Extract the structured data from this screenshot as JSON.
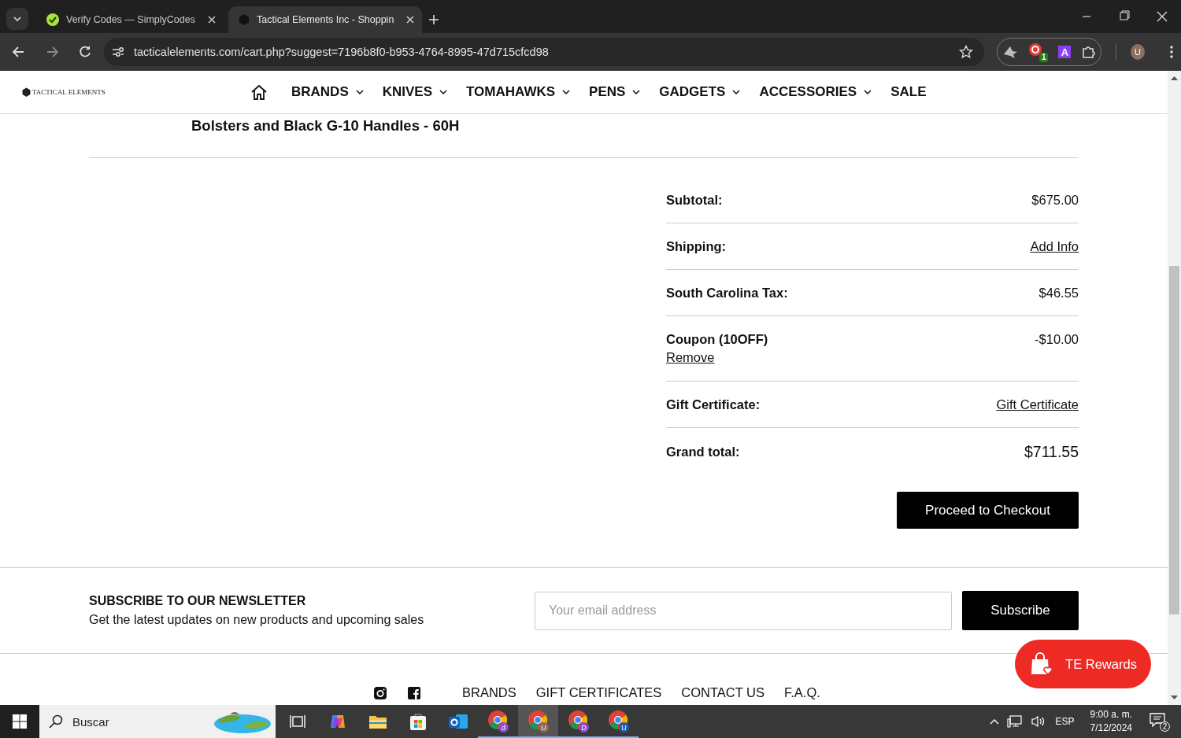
{
  "browser": {
    "tabs": [
      {
        "title": "Verify Codes — SimplyCodes",
        "selected": false
      },
      {
        "title": "Tactical Elements Inc - Shoppin",
        "selected": true
      }
    ],
    "url": "tacticalelements.com/cart.php?suggest=7196b8f0-b953-4764-8995-47d715cfcd98",
    "extension_badge": "1",
    "extension_letter": "A",
    "profile_initial": "U"
  },
  "site": {
    "logo": "TACTICAL ELEMENTS",
    "nav": [
      {
        "label": "BRANDS",
        "kind": "menu"
      },
      {
        "label": "KNIVES",
        "kind": "menu"
      },
      {
        "label": "TOMAHAWKS",
        "kind": "menu"
      },
      {
        "label": "PENS",
        "kind": "menu"
      },
      {
        "label": "GADGETS",
        "kind": "menu"
      },
      {
        "label": "ACCESSORIES",
        "kind": "menu"
      },
      {
        "label": "SALE",
        "kind": "link"
      }
    ]
  },
  "cart": {
    "item_title": "Bolsters and Black G-10 Handles - 60H",
    "totals": [
      {
        "label": "Subtotal:",
        "kind": "value",
        "value": "$675.00"
      },
      {
        "label": "Shipping:",
        "kind": "link",
        "value": "Add Info"
      },
      {
        "label": "South Carolina Tax:",
        "kind": "value",
        "value": "$46.55"
      },
      {
        "label": "Coupon (10OFF)",
        "kind": "coupon",
        "value": "-$10.00",
        "action": "Remove"
      },
      {
        "label": "Gift Certificate:",
        "kind": "link",
        "value": "Gift Certificate"
      },
      {
        "label": "Grand total:",
        "kind": "grand",
        "value": "$711.55"
      }
    ],
    "checkout_button": "Proceed to Checkout"
  },
  "newsletter": {
    "heading": "SUBSCRIBE TO OUR NEWSLETTER",
    "text": "Get the latest updates on new products and upcoming sales",
    "placeholder": "Your email address",
    "button": "Subscribe"
  },
  "footer": {
    "links": [
      "BRANDS",
      "GIFT CERTIFICATES",
      "CONTACT US",
      "F.A.Q."
    ]
  },
  "rewards_button": "TE Rewards",
  "taskbar": {
    "search_placeholder": "Buscar",
    "apps": [
      {
        "kind": "taskview",
        "selected": false
      },
      {
        "kind": "copilot",
        "selected": false
      },
      {
        "kind": "explorer",
        "selected": false
      },
      {
        "kind": "store",
        "selected": false
      },
      {
        "kind": "outlook",
        "selected": false
      },
      {
        "kind": "chrome",
        "badge": "d",
        "color": "#8a4fc8",
        "selected": false
      },
      {
        "kind": "chrome",
        "badge": "U",
        "color": "#8a6a5a",
        "selected": true
      },
      {
        "kind": "chrome",
        "badge": "D",
        "color": "#8a4fc8",
        "selected": false
      },
      {
        "kind": "chrome",
        "badge": "U",
        "color": "#1f5fa8",
        "selected": false
      }
    ],
    "language": "ESP",
    "time": "9:00 a. m.",
    "date": "7/12/2024",
    "notifications": "2"
  }
}
